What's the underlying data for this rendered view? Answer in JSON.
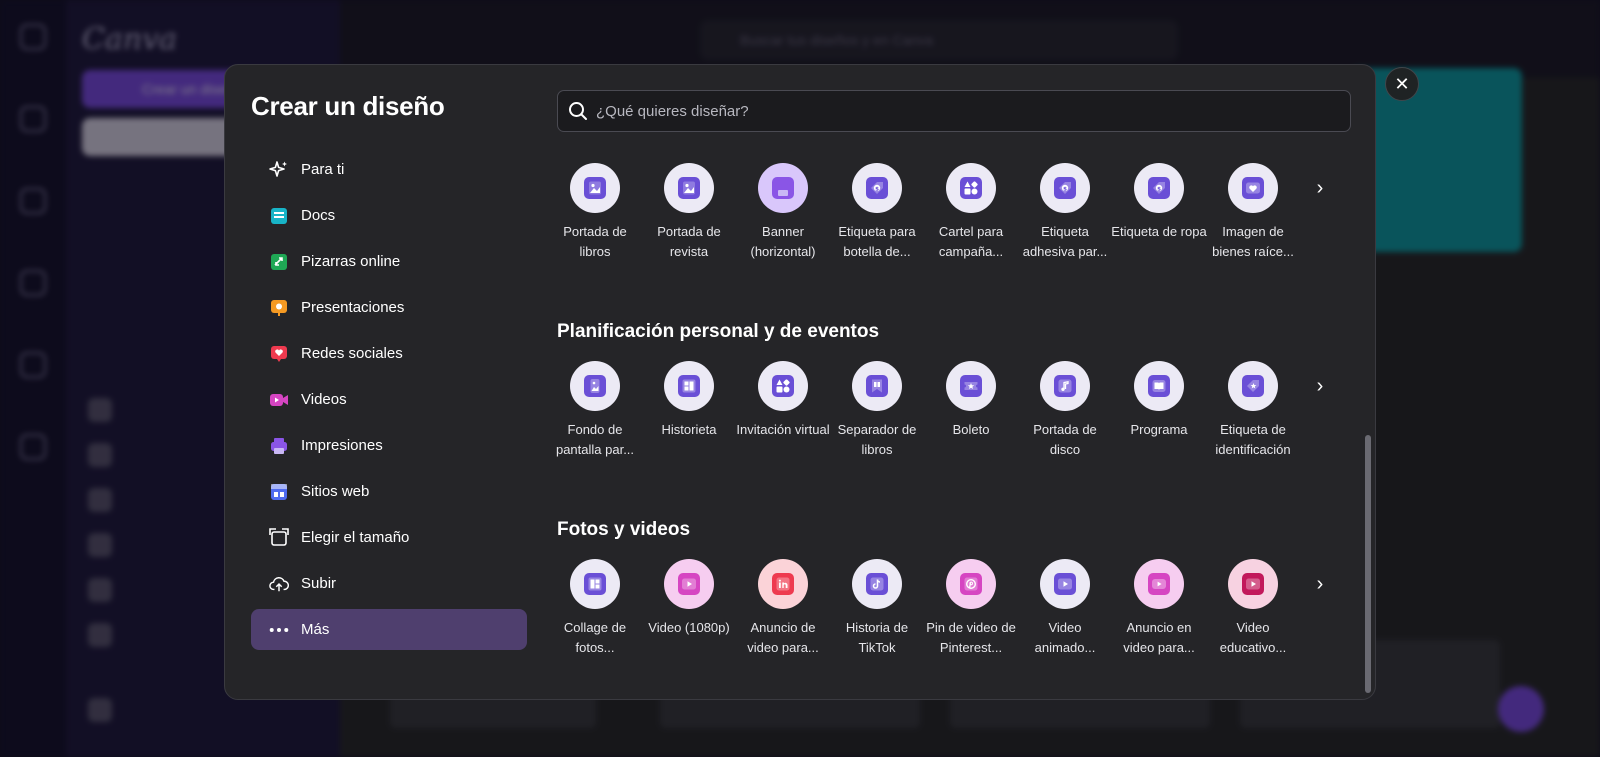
{
  "modal": {
    "title": "Crear un diseño",
    "close_icon": "close-icon",
    "search": {
      "placeholder": "¿Qué quieres diseñar?",
      "value": ""
    }
  },
  "nav": [
    {
      "label": "Para ti",
      "icon": "sparkles-icon",
      "color": "#ffffff",
      "active": false
    },
    {
      "label": "Docs",
      "icon": "docs-icon",
      "color": "#18b4c7",
      "active": false
    },
    {
      "label": "Pizarras online",
      "icon": "whiteboard-icon",
      "color": "#1fa855",
      "active": false
    },
    {
      "label": "Presentaciones",
      "icon": "presentation-icon",
      "color": "#f59a23",
      "active": false
    },
    {
      "label": "Redes sociales",
      "icon": "heart-icon",
      "color": "#ee3a4f",
      "active": false
    },
    {
      "label": "Videos",
      "icon": "video-icon",
      "color": "#d645c2",
      "active": false
    },
    {
      "label": "Impresiones",
      "icon": "print-icon",
      "color": "#8a55e6",
      "active": false
    },
    {
      "label": "Sitios web",
      "icon": "website-icon",
      "color": "#4f6bf0",
      "active": false
    },
    {
      "label": "Elegir el tamaño",
      "icon": "resize-icon",
      "color": "#ffffff",
      "active": false
    },
    {
      "label": "Subir",
      "icon": "cloud-upload-icon",
      "color": "#ffffff",
      "active": false
    },
    {
      "label": "Más",
      "icon": "more-icon",
      "color": "#ffffff",
      "active": true
    }
  ],
  "sections": [
    {
      "title": "",
      "items": [
        {
          "label": "Portada de libros",
          "icon": "image-icon",
          "color": "#6a4fd6"
        },
        {
          "label": "Portada de revista",
          "icon": "image-icon",
          "color": "#6a4fd6"
        },
        {
          "label": "Banner (horizontal)",
          "icon": "print-icon",
          "color": "#8a55e6"
        },
        {
          "label": "Etiqueta para botella de...",
          "icon": "price-tag-icon",
          "color": "#6a4fd6"
        },
        {
          "label": "Cartel para campaña...",
          "icon": "shapes-icon",
          "color": "#6a4fd6"
        },
        {
          "label": "Etiqueta adhesiva par...",
          "icon": "price-tag-icon",
          "color": "#6a4fd6"
        },
        {
          "label": "Etiqueta de ropa",
          "icon": "price-tag-icon",
          "color": "#6a4fd6"
        },
        {
          "label": "Imagen de bienes raíce...",
          "icon": "heart-card-icon",
          "color": "#6a4fd6"
        }
      ]
    },
    {
      "title": "Planificación personal y de eventos",
      "items": [
        {
          "label": "Fondo de pantalla par...",
          "icon": "phone-image-icon",
          "color": "#6a4fd6"
        },
        {
          "label": "Historieta",
          "icon": "comic-icon",
          "color": "#6a4fd6"
        },
        {
          "label": "Invitación virtual",
          "icon": "shapes-icon",
          "color": "#6a4fd6"
        },
        {
          "label": "Separador de libros",
          "icon": "bookmark-icon",
          "color": "#6a4fd6"
        },
        {
          "label": "Boleto",
          "icon": "ticket-icon",
          "color": "#6a4fd6"
        },
        {
          "label": "Portada de disco",
          "icon": "music-icon",
          "color": "#6a4fd6"
        },
        {
          "label": "Programa",
          "icon": "book-open-icon",
          "color": "#6a4fd6"
        },
        {
          "label": "Etiqueta de identificación",
          "icon": "star-tag-icon",
          "color": "#6a4fd6"
        }
      ]
    },
    {
      "title": "Fotos y videos",
      "items": [
        {
          "label": "Collage de fotos...",
          "icon": "collage-icon",
          "color": "#6a4fd6"
        },
        {
          "label": "Video (1080p)",
          "icon": "play-icon",
          "color": "#d645c2"
        },
        {
          "label": "Anuncio de video para...",
          "icon": "linkedin-icon",
          "color": "#ee3a4f"
        },
        {
          "label": "Historia de TikTok",
          "icon": "tiktok-icon",
          "color": "#6a4fd6"
        },
        {
          "label": "Pin de video de Pinterest...",
          "icon": "pinterest-icon",
          "color": "#d645c2"
        },
        {
          "label": "Video animado...",
          "icon": "play-icon",
          "color": "#6a4fd6"
        },
        {
          "label": "Anuncio en video para...",
          "icon": "youtube-icon",
          "color": "#d645c2"
        },
        {
          "label": "Video educativo...",
          "icon": "play-icon",
          "color": "#c2185b"
        }
      ]
    }
  ],
  "background": {
    "logo": "Canva",
    "create_button": "Crear un diseño",
    "search_placeholder": "Buscar tus diseños y en Canva"
  }
}
